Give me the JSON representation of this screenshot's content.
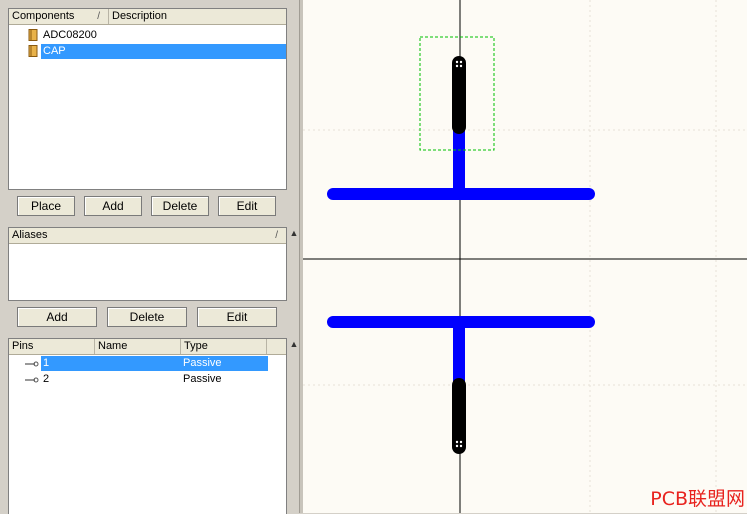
{
  "components_panel": {
    "columns": [
      "Components",
      "Description"
    ],
    "sort_indicator": "/",
    "items": [
      {
        "name": "ADC08200",
        "selected": false
      },
      {
        "name": "CAP",
        "selected": true
      }
    ]
  },
  "component_buttons": {
    "place": "Place",
    "add": "Add",
    "delete": "Delete",
    "edit": "Edit"
  },
  "aliases_panel": {
    "column": "Aliases",
    "sort_indicator": "/"
  },
  "alias_buttons": {
    "add": "Add",
    "delete": "Delete",
    "edit": "Edit"
  },
  "pins_panel": {
    "columns": [
      "Pins",
      "Name",
      "Type"
    ],
    "rows": [
      {
        "pin": "1",
        "name": "",
        "type": "Passive",
        "selected": true
      },
      {
        "pin": "2",
        "name": "",
        "type": "Passive",
        "selected": false
      }
    ]
  },
  "watermark": "PCB联盟网",
  "colors": {
    "selection": "#3399ff",
    "pin_body": "#000000",
    "symbol_line": "#0000ff",
    "selection_box": "#00c000"
  }
}
